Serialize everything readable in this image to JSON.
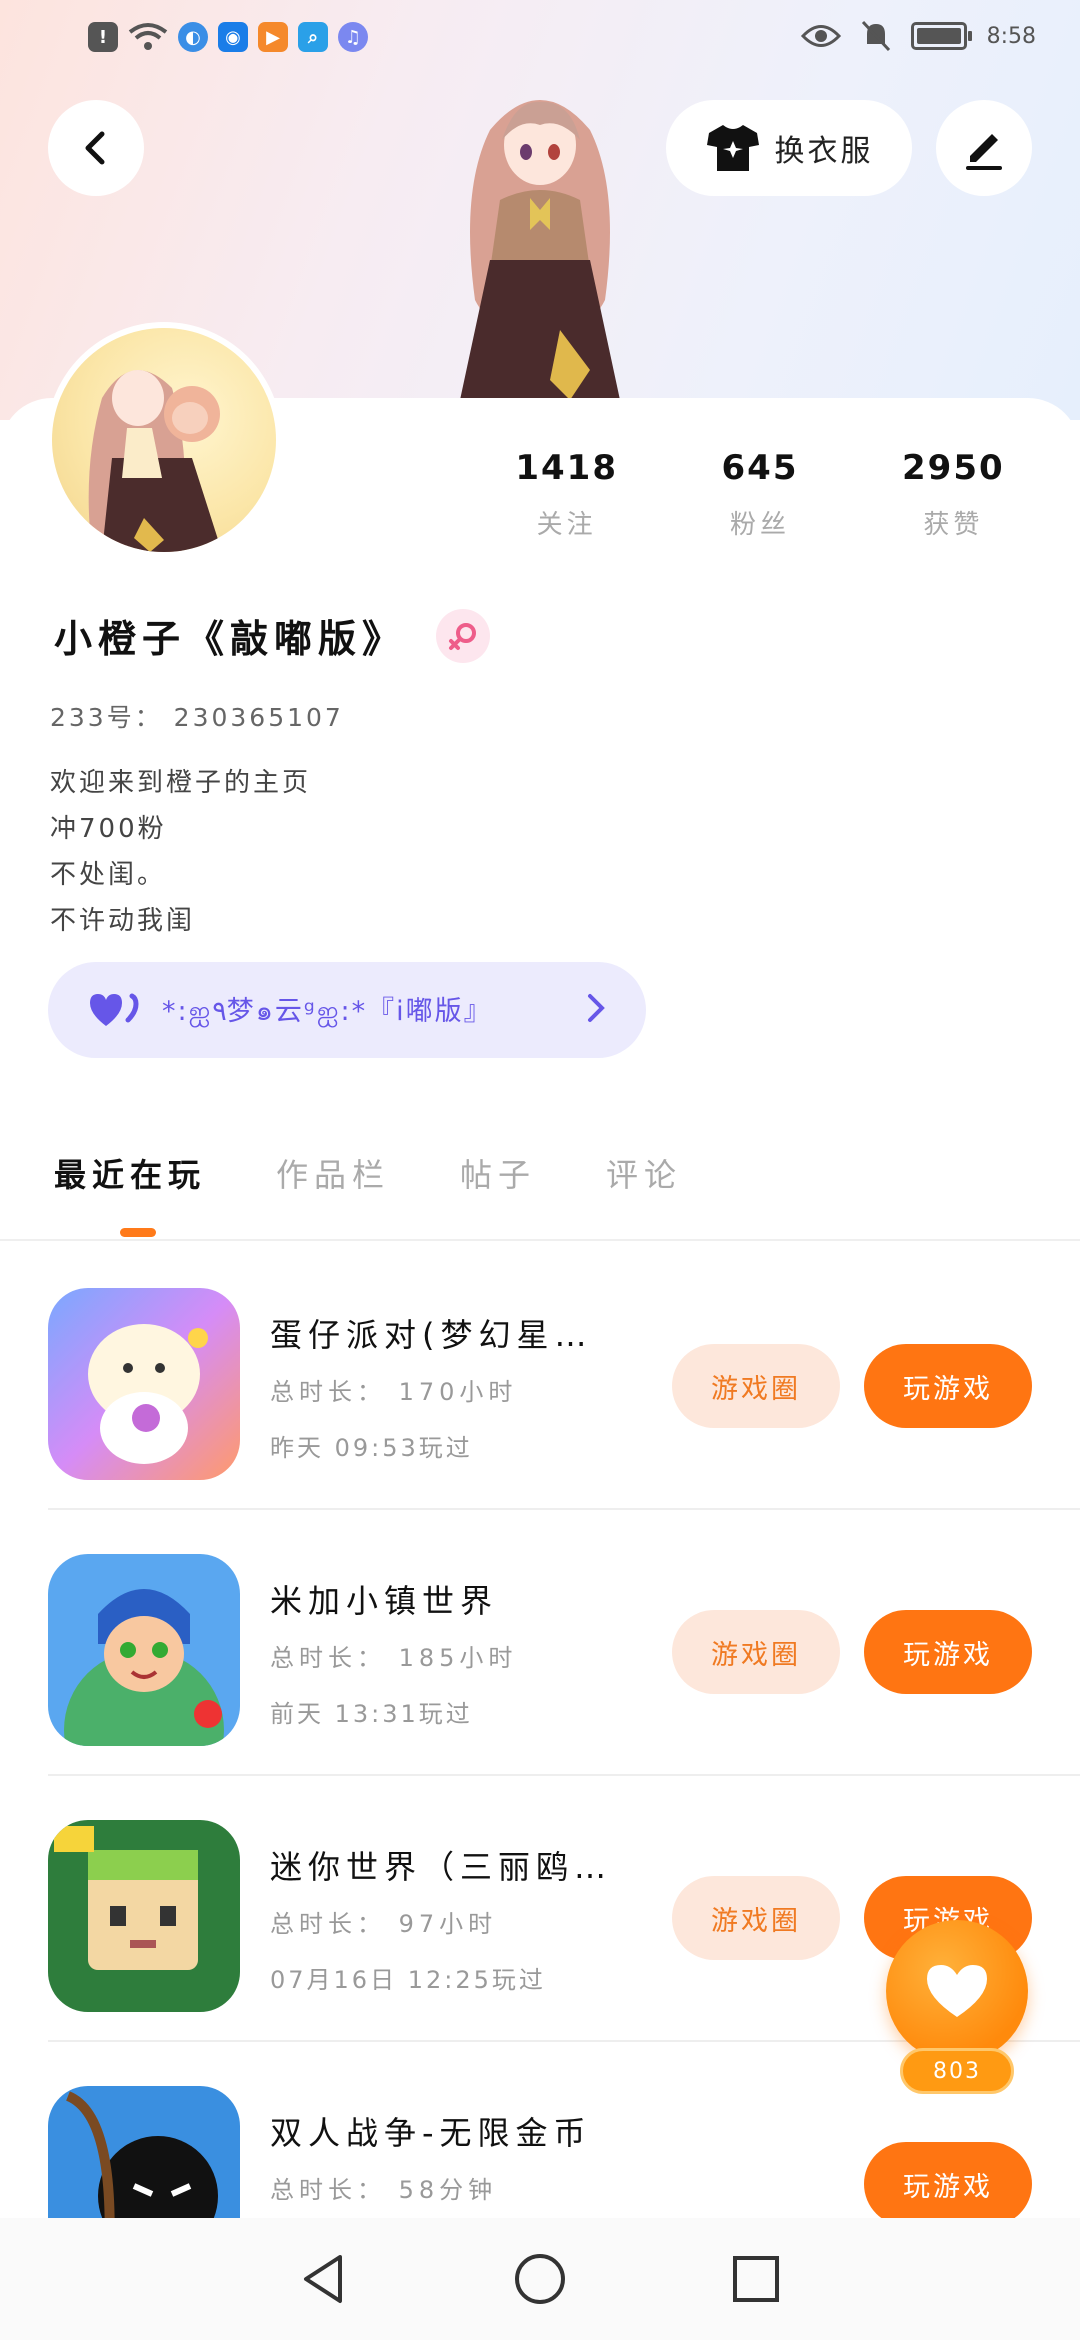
{
  "status_bar": {
    "time": "8:58",
    "icons": [
      "alert-icon",
      "wifi-icon",
      "browser-icon",
      "bulb-icon",
      "video-icon",
      "search-app-icon",
      "music-icon"
    ]
  },
  "header": {
    "outfit_label": "换衣服"
  },
  "profile": {
    "stats": [
      {
        "value": "1418",
        "label": "关注"
      },
      {
        "value": "645",
        "label": "粉丝"
      },
      {
        "value": "2950",
        "label": "获赞"
      }
    ],
    "name": "小橙子《敲嘟版》",
    "uid": "233号： 230365107",
    "bio": [
      "欢迎来到橙子的主页",
      "冲700粉",
      "不处闺。",
      "不许动我闺"
    ],
    "club": "*:ஐ٩梦๑云ᵍஐ:*『i嘟版』"
  },
  "tabs": [
    "最近在玩",
    "作品栏",
    "帖子",
    "评论"
  ],
  "games": [
    {
      "title": "蛋仔派对(梦幻星…",
      "duration": "总时长： 170小时",
      "last_played": "昨天 09:53玩过",
      "circle_label": "游戏圈",
      "play_label": "玩游戏"
    },
    {
      "title": "米加小镇世界",
      "duration": "总时长： 185小时",
      "last_played": "前天 13:31玩过",
      "circle_label": "游戏圈",
      "play_label": "玩游戏"
    },
    {
      "title": "迷你世界（三丽鸥…",
      "duration": "总时长： 97小时",
      "last_played": "07月16日 12:25玩过",
      "circle_label": "游戏圈",
      "play_label": "玩游戏"
    },
    {
      "title": "双人战争-无限金币",
      "duration": "总时长： 58分钟",
      "last_played": "",
      "circle_label": "",
      "play_label": "玩游戏"
    }
  ],
  "like_count": "803",
  "colors": {
    "accent": "#ff7512",
    "club_text": "#6656e8",
    "club_bg": "#ecebfd"
  }
}
